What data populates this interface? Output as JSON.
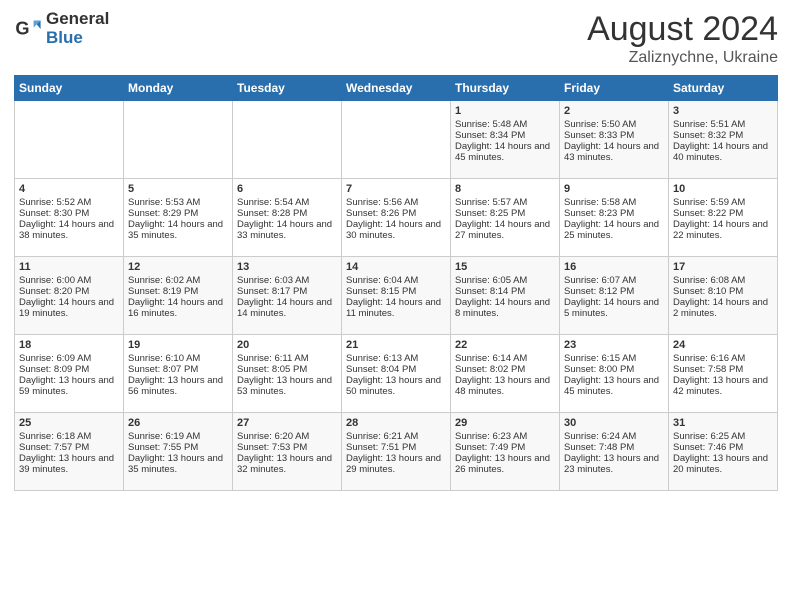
{
  "header": {
    "logo_general": "General",
    "logo_blue": "Blue",
    "title": "August 2024",
    "location": "Zaliznychne, Ukraine"
  },
  "days_of_week": [
    "Sunday",
    "Monday",
    "Tuesday",
    "Wednesday",
    "Thursday",
    "Friday",
    "Saturday"
  ],
  "weeks": [
    [
      {
        "day": "",
        "content": ""
      },
      {
        "day": "",
        "content": ""
      },
      {
        "day": "",
        "content": ""
      },
      {
        "day": "",
        "content": ""
      },
      {
        "day": "1",
        "content": "Sunrise: 5:48 AM\nSunset: 8:34 PM\nDaylight: 14 hours and 45 minutes."
      },
      {
        "day": "2",
        "content": "Sunrise: 5:50 AM\nSunset: 8:33 PM\nDaylight: 14 hours and 43 minutes."
      },
      {
        "day": "3",
        "content": "Sunrise: 5:51 AM\nSunset: 8:32 PM\nDaylight: 14 hours and 40 minutes."
      }
    ],
    [
      {
        "day": "4",
        "content": "Sunrise: 5:52 AM\nSunset: 8:30 PM\nDaylight: 14 hours and 38 minutes."
      },
      {
        "day": "5",
        "content": "Sunrise: 5:53 AM\nSunset: 8:29 PM\nDaylight: 14 hours and 35 minutes."
      },
      {
        "day": "6",
        "content": "Sunrise: 5:54 AM\nSunset: 8:28 PM\nDaylight: 14 hours and 33 minutes."
      },
      {
        "day": "7",
        "content": "Sunrise: 5:56 AM\nSunset: 8:26 PM\nDaylight: 14 hours and 30 minutes."
      },
      {
        "day": "8",
        "content": "Sunrise: 5:57 AM\nSunset: 8:25 PM\nDaylight: 14 hours and 27 minutes."
      },
      {
        "day": "9",
        "content": "Sunrise: 5:58 AM\nSunset: 8:23 PM\nDaylight: 14 hours and 25 minutes."
      },
      {
        "day": "10",
        "content": "Sunrise: 5:59 AM\nSunset: 8:22 PM\nDaylight: 14 hours and 22 minutes."
      }
    ],
    [
      {
        "day": "11",
        "content": "Sunrise: 6:00 AM\nSunset: 8:20 PM\nDaylight: 14 hours and 19 minutes."
      },
      {
        "day": "12",
        "content": "Sunrise: 6:02 AM\nSunset: 8:19 PM\nDaylight: 14 hours and 16 minutes."
      },
      {
        "day": "13",
        "content": "Sunrise: 6:03 AM\nSunset: 8:17 PM\nDaylight: 14 hours and 14 minutes."
      },
      {
        "day": "14",
        "content": "Sunrise: 6:04 AM\nSunset: 8:15 PM\nDaylight: 14 hours and 11 minutes."
      },
      {
        "day": "15",
        "content": "Sunrise: 6:05 AM\nSunset: 8:14 PM\nDaylight: 14 hours and 8 minutes."
      },
      {
        "day": "16",
        "content": "Sunrise: 6:07 AM\nSunset: 8:12 PM\nDaylight: 14 hours and 5 minutes."
      },
      {
        "day": "17",
        "content": "Sunrise: 6:08 AM\nSunset: 8:10 PM\nDaylight: 14 hours and 2 minutes."
      }
    ],
    [
      {
        "day": "18",
        "content": "Sunrise: 6:09 AM\nSunset: 8:09 PM\nDaylight: 13 hours and 59 minutes."
      },
      {
        "day": "19",
        "content": "Sunrise: 6:10 AM\nSunset: 8:07 PM\nDaylight: 13 hours and 56 minutes."
      },
      {
        "day": "20",
        "content": "Sunrise: 6:11 AM\nSunset: 8:05 PM\nDaylight: 13 hours and 53 minutes."
      },
      {
        "day": "21",
        "content": "Sunrise: 6:13 AM\nSunset: 8:04 PM\nDaylight: 13 hours and 50 minutes."
      },
      {
        "day": "22",
        "content": "Sunrise: 6:14 AM\nSunset: 8:02 PM\nDaylight: 13 hours and 48 minutes."
      },
      {
        "day": "23",
        "content": "Sunrise: 6:15 AM\nSunset: 8:00 PM\nDaylight: 13 hours and 45 minutes."
      },
      {
        "day": "24",
        "content": "Sunrise: 6:16 AM\nSunset: 7:58 PM\nDaylight: 13 hours and 42 minutes."
      }
    ],
    [
      {
        "day": "25",
        "content": "Sunrise: 6:18 AM\nSunset: 7:57 PM\nDaylight: 13 hours and 39 minutes."
      },
      {
        "day": "26",
        "content": "Sunrise: 6:19 AM\nSunset: 7:55 PM\nDaylight: 13 hours and 35 minutes."
      },
      {
        "day": "27",
        "content": "Sunrise: 6:20 AM\nSunset: 7:53 PM\nDaylight: 13 hours and 32 minutes."
      },
      {
        "day": "28",
        "content": "Sunrise: 6:21 AM\nSunset: 7:51 PM\nDaylight: 13 hours and 29 minutes."
      },
      {
        "day": "29",
        "content": "Sunrise: 6:23 AM\nSunset: 7:49 PM\nDaylight: 13 hours and 26 minutes."
      },
      {
        "day": "30",
        "content": "Sunrise: 6:24 AM\nSunset: 7:48 PM\nDaylight: 13 hours and 23 minutes."
      },
      {
        "day": "31",
        "content": "Sunrise: 6:25 AM\nSunset: 7:46 PM\nDaylight: 13 hours and 20 minutes."
      }
    ]
  ]
}
